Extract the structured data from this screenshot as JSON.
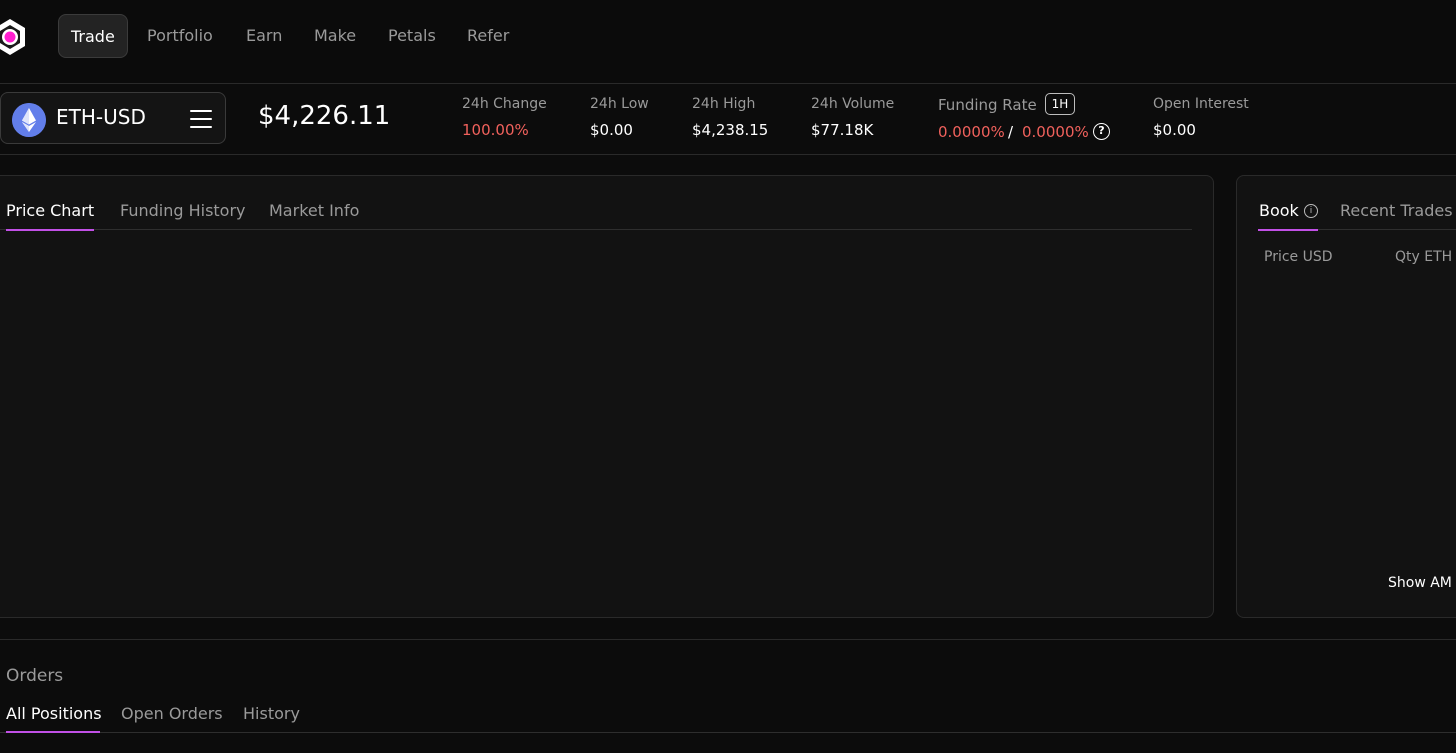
{
  "nav": {
    "items": [
      {
        "label": "Trade",
        "active": true
      },
      {
        "label": "Portfolio"
      },
      {
        "label": "Earn"
      },
      {
        "label": "Make"
      },
      {
        "label": "Petals"
      },
      {
        "label": "Refer"
      }
    ],
    "logo_icon": "flower-logo-icon"
  },
  "market": {
    "pair": "ETH-USD",
    "pair_icon": "ethereum-icon",
    "last_price": "$4,226.11",
    "stats": {
      "change_label": "24h Change",
      "change_value": "100.00%",
      "low_label": "24h Low",
      "low_value": "$0.00",
      "high_label": "24h High",
      "high_value": "$4,238.15",
      "volume_label": "24h Volume",
      "volume_value": "$77.18K",
      "funding_label": "Funding Rate",
      "funding_interval": "1H",
      "funding_value_a": "0.0000%",
      "funding_sep": "/",
      "funding_value_b": "0.0000%",
      "oi_label": "Open Interest",
      "oi_value": "$0.00"
    }
  },
  "chart_panel": {
    "tabs": [
      {
        "label": "Price Chart",
        "active": true
      },
      {
        "label": "Funding History"
      },
      {
        "label": "Market Info"
      }
    ]
  },
  "book_panel": {
    "tabs": [
      {
        "label": "Book",
        "active": true
      },
      {
        "label": "Recent Trades"
      }
    ],
    "columns": [
      "Price USD",
      "Qty ETH"
    ],
    "show_amount": "Show AM"
  },
  "orders": {
    "title": "Orders",
    "tabs": [
      {
        "label": "All Positions",
        "active": true
      },
      {
        "label": "Open Orders"
      },
      {
        "label": "History"
      }
    ]
  },
  "colors": {
    "accent": "#c150e6",
    "negative": "#f0615c",
    "background": "#0c0c0c",
    "panel": "#121212"
  }
}
